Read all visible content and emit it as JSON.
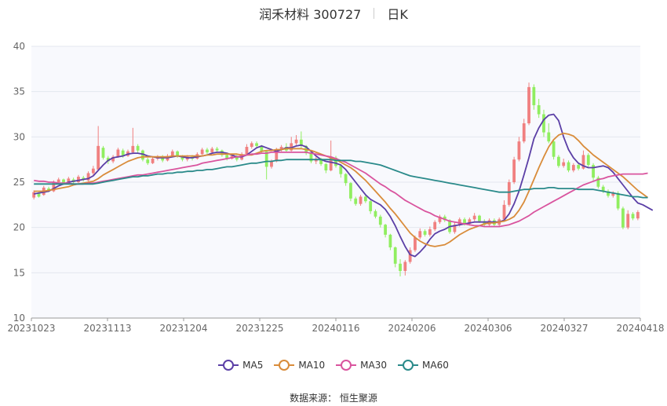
{
  "header": {
    "title": "润禾材料 300727",
    "period": "日K"
  },
  "source_text": "数据来源：  恒生聚源",
  "chart_data": {
    "type": "candlestick",
    "ylim": [
      10,
      40
    ],
    "yticks": [
      10,
      15,
      20,
      25,
      30,
      35,
      40
    ],
    "xtick_labels": [
      "20231023",
      "20231113",
      "20231204",
      "20231225",
      "20240116",
      "20240206",
      "20240306",
      "20240327",
      "20240418"
    ],
    "up_color": "#f08080",
    "down_color": "#90ee60",
    "grid": true,
    "legend_position": "bottom",
    "candles": [
      [
        23.3,
        23.9,
        23.1,
        24.1
      ],
      [
        23.8,
        23.4,
        23.3,
        23.9
      ],
      [
        23.6,
        24.4,
        23.5,
        24.6
      ],
      [
        24.3,
        24.1,
        23.9,
        24.5
      ],
      [
        24.0,
        25.0,
        23.9,
        25.2
      ],
      [
        25.0,
        25.3,
        24.8,
        25.5
      ],
      [
        25.3,
        24.9,
        24.7,
        25.4
      ],
      [
        24.9,
        25.4,
        24.8,
        25.6
      ],
      [
        25.3,
        25.0,
        24.8,
        25.5
      ],
      [
        25.0,
        25.6,
        24.9,
        25.8
      ],
      [
        25.5,
        25.3,
        25.1,
        25.7
      ],
      [
        25.2,
        26.0,
        25.1,
        26.2
      ],
      [
        26.0,
        26.5,
        25.8,
        26.8
      ],
      [
        26.4,
        29.0,
        26.3,
        31.2
      ],
      [
        28.8,
        27.7,
        27.5,
        29.0
      ],
      [
        27.7,
        27.3,
        27.0,
        27.9
      ],
      [
        27.3,
        27.8,
        27.1,
        28.0
      ],
      [
        27.8,
        28.6,
        27.7,
        28.8
      ],
      [
        28.5,
        27.9,
        27.7,
        28.7
      ],
      [
        27.9,
        28.4,
        27.8,
        28.6
      ],
      [
        28.3,
        29.0,
        28.1,
        31.0
      ],
      [
        29.0,
        28.5,
        28.2,
        29.2
      ],
      [
        28.5,
        27.5,
        27.3,
        28.6
      ],
      [
        27.5,
        27.1,
        26.9,
        27.7
      ],
      [
        27.1,
        27.6,
        27.0,
        27.8
      ],
      [
        27.6,
        27.8,
        27.4,
        28.0
      ],
      [
        27.8,
        27.4,
        27.2,
        28.0
      ],
      [
        27.4,
        27.9,
        27.3,
        28.1
      ],
      [
        27.9,
        28.4,
        27.8,
        28.6
      ],
      [
        28.4,
        27.9,
        27.7,
        28.5
      ],
      [
        27.9,
        27.5,
        27.3,
        28.0
      ],
      [
        27.5,
        27.8,
        27.3,
        28.0
      ],
      [
        27.8,
        27.6,
        27.4,
        28.0
      ],
      [
        27.6,
        28.1,
        27.5,
        28.3
      ],
      [
        28.1,
        28.6,
        28.0,
        28.8
      ],
      [
        28.6,
        28.3,
        28.1,
        28.8
      ],
      [
        28.3,
        28.7,
        28.2,
        28.9
      ],
      [
        28.7,
        28.5,
        28.3,
        28.9
      ],
      [
        28.5,
        28.0,
        27.8,
        28.6
      ],
      [
        28.0,
        27.6,
        27.4,
        28.1
      ],
      [
        27.6,
        27.9,
        27.5,
        28.1
      ],
      [
        27.9,
        27.5,
        27.3,
        28.0
      ],
      [
        27.5,
        28.1,
        27.4,
        28.3
      ],
      [
        28.1,
        28.9,
        28.0,
        29.2
      ],
      [
        28.9,
        29.3,
        28.7,
        29.5
      ],
      [
        29.3,
        29.0,
        28.8,
        29.5
      ],
      [
        29.0,
        28.4,
        28.2,
        29.1
      ],
      [
        28.4,
        26.7,
        25.3,
        28.5
      ],
      [
        26.7,
        27.3,
        26.5,
        27.5
      ],
      [
        27.3,
        28.6,
        27.2,
        28.8
      ],
      [
        28.6,
        28.9,
        28.4,
        29.1
      ],
      [
        28.9,
        28.5,
        28.3,
        29.3
      ],
      [
        28.5,
        29.3,
        28.4,
        30.0
      ],
      [
        29.3,
        29.7,
        29.1,
        30.2
      ],
      [
        29.7,
        29.0,
        28.8,
        30.6
      ],
      [
        29.0,
        28.2,
        28.0,
        29.1
      ],
      [
        28.2,
        27.3,
        27.1,
        28.3
      ],
      [
        27.3,
        27.6,
        27.0,
        27.8
      ],
      [
        27.6,
        27.0,
        26.8,
        27.7
      ],
      [
        27.0,
        26.3,
        26.0,
        27.1
      ],
      [
        26.3,
        27.7,
        26.2,
        29.6
      ],
      [
        27.7,
        26.8,
        26.6,
        27.9
      ],
      [
        26.8,
        25.9,
        25.5,
        26.9
      ],
      [
        25.9,
        24.9,
        24.6,
        26.0
      ],
      [
        24.9,
        23.2,
        22.9,
        25.0
      ],
      [
        23.2,
        22.6,
        22.4,
        23.4
      ],
      [
        22.6,
        23.4,
        22.4,
        23.6
      ],
      [
        23.4,
        22.9,
        22.7,
        23.6
      ],
      [
        22.9,
        21.8,
        21.5,
        23.0
      ],
      [
        21.8,
        21.2,
        21.0,
        22.0
      ],
      [
        21.2,
        20.3,
        20.0,
        21.4
      ],
      [
        20.3,
        19.2,
        18.9,
        20.4
      ],
      [
        19.2,
        17.8,
        17.5,
        19.3
      ],
      [
        17.8,
        16.0,
        15.6,
        17.9
      ],
      [
        16.0,
        15.2,
        14.6,
        16.5
      ],
      [
        15.2,
        16.2,
        14.7,
        16.4
      ],
      [
        16.2,
        17.5,
        16.0,
        17.8
      ],
      [
        17.5,
        18.9,
        17.3,
        19.1
      ],
      [
        18.9,
        19.6,
        18.7,
        19.9
      ],
      [
        19.6,
        19.2,
        19.0,
        19.8
      ],
      [
        19.2,
        19.8,
        19.0,
        20.1
      ],
      [
        19.8,
        20.6,
        19.6,
        20.8
      ],
      [
        20.6,
        21.2,
        20.4,
        21.4
      ],
      [
        21.2,
        20.8,
        20.6,
        21.4
      ],
      [
        20.8,
        19.5,
        19.3,
        20.9
      ],
      [
        19.5,
        20.3,
        19.3,
        20.6
      ],
      [
        20.3,
        20.9,
        20.1,
        21.1
      ],
      [
        20.9,
        20.4,
        20.2,
        21.1
      ],
      [
        20.4,
        20.9,
        20.2,
        21.1
      ],
      [
        20.9,
        21.3,
        20.7,
        21.6
      ],
      [
        21.3,
        20.7,
        20.5,
        21.4
      ],
      [
        20.7,
        20.3,
        20.1,
        20.9
      ],
      [
        20.3,
        20.8,
        20.1,
        21.0
      ],
      [
        20.8,
        20.3,
        20.1,
        21.0
      ],
      [
        20.3,
        20.9,
        20.1,
        21.1
      ],
      [
        20.9,
        22.5,
        20.8,
        23.0
      ],
      [
        22.5,
        25.0,
        22.3,
        25.3
      ],
      [
        25.0,
        27.5,
        24.8,
        27.8
      ],
      [
        27.5,
        29.5,
        27.3,
        30.0
      ],
      [
        29.5,
        31.5,
        29.3,
        32.0
      ],
      [
        31.5,
        35.5,
        31.3,
        36.0
      ],
      [
        35.5,
        33.5,
        33.0,
        35.8
      ],
      [
        33.5,
        32.5,
        32.1,
        34.2
      ],
      [
        32.5,
        30.5,
        30.0,
        33.0
      ],
      [
        30.5,
        29.5,
        29.3,
        31.5
      ],
      [
        29.5,
        27.8,
        27.5,
        29.7
      ],
      [
        27.8,
        26.8,
        26.6,
        28.0
      ],
      [
        26.8,
        27.2,
        26.6,
        27.6
      ],
      [
        27.2,
        26.3,
        26.1,
        27.4
      ],
      [
        26.3,
        26.9,
        26.1,
        27.1
      ],
      [
        26.9,
        26.5,
        26.3,
        27.1
      ],
      [
        26.5,
        28.0,
        26.4,
        28.5
      ],
      [
        28.0,
        26.9,
        26.7,
        28.2
      ],
      [
        26.9,
        25.5,
        25.2,
        27.1
      ],
      [
        25.5,
        24.5,
        24.3,
        25.7
      ],
      [
        24.5,
        24.0,
        23.8,
        24.7
      ],
      [
        24.0,
        23.5,
        23.3,
        24.2
      ],
      [
        23.5,
        23.8,
        23.3,
        24.0
      ],
      [
        23.8,
        22.1,
        21.9,
        24.0
      ],
      [
        22.1,
        20.0,
        19.8,
        22.3
      ],
      [
        20.0,
        21.5,
        19.8,
        21.9
      ],
      [
        21.5,
        21.0,
        20.8,
        21.7
      ],
      [
        21.0,
        21.7,
        20.8,
        21.9
      ]
    ],
    "series": [
      {
        "name": "MA5",
        "color": "#5b3fa6",
        "values": [
          23.7,
          23.8,
          23.9,
          24.0,
          24.3,
          24.6,
          24.8,
          25.0,
          25.1,
          25.2,
          25.3,
          25.4,
          25.7,
          26.3,
          26.9,
          27.4,
          27.7,
          27.8,
          27.9,
          28.1,
          28.2,
          28.2,
          28.1,
          27.9,
          27.8,
          27.7,
          27.7,
          27.7,
          27.8,
          27.9,
          27.8,
          27.7,
          27.7,
          27.8,
          27.9,
          28.0,
          28.2,
          28.3,
          28.3,
          28.2,
          28.0,
          27.8,
          27.8,
          28.0,
          28.4,
          28.8,
          29.0,
          28.8,
          28.6,
          28.4,
          28.6,
          28.8,
          28.8,
          29.0,
          29.1,
          28.9,
          28.4,
          27.9,
          27.5,
          27.3,
          27.2,
          27.1,
          26.9,
          26.4,
          25.7,
          25.0,
          24.3,
          23.6,
          23.1,
          22.8,
          22.5,
          22.0,
          21.2,
          20.2,
          19.0,
          17.9,
          17.0,
          16.8,
          17.3,
          17.9,
          18.7,
          19.3,
          19.6,
          19.8,
          20.1,
          20.2,
          20.3,
          20.4,
          20.5,
          20.6,
          20.6,
          20.6,
          20.6,
          20.6,
          20.6,
          20.8,
          21.5,
          22.6,
          24.0,
          25.8,
          27.7,
          29.8,
          31.0,
          31.9,
          32.4,
          32.5,
          31.8,
          30.0,
          28.6,
          27.7,
          27.1,
          26.8,
          26.6,
          26.6,
          26.7,
          26.8,
          26.6,
          26.1,
          25.4,
          24.7,
          24.0,
          23.3,
          22.7,
          22.5,
          22.2,
          21.9
        ]
      },
      {
        "name": "MA10",
        "color": "#d98c3a",
        "values": [
          24.0,
          24.0,
          24.0,
          24.1,
          24.2,
          24.3,
          24.4,
          24.5,
          24.7,
          24.8,
          24.9,
          25.0,
          25.1,
          25.4,
          25.8,
          26.1,
          26.4,
          26.7,
          27.0,
          27.3,
          27.5,
          27.7,
          27.8,
          27.8,
          27.8,
          27.8,
          27.8,
          27.8,
          27.9,
          27.9,
          27.9,
          27.9,
          27.9,
          27.9,
          27.9,
          28.0,
          28.0,
          28.1,
          28.1,
          28.1,
          28.1,
          28.1,
          28.0,
          28.0,
          28.0,
          28.2,
          28.4,
          28.5,
          28.5,
          28.6,
          28.6,
          28.7,
          28.7,
          28.7,
          28.7,
          28.6,
          28.5,
          28.3,
          28.1,
          27.9,
          27.7,
          27.5,
          27.2,
          26.9,
          26.6,
          26.2,
          25.7,
          25.2,
          24.6,
          24.0,
          23.4,
          22.8,
          22.1,
          21.5,
          20.8,
          20.1,
          19.4,
          18.9,
          18.5,
          18.2,
          18.0,
          17.9,
          18.0,
          18.1,
          18.4,
          18.8,
          19.2,
          19.5,
          19.8,
          20.0,
          20.2,
          20.4,
          20.5,
          20.5,
          20.6,
          20.7,
          20.9,
          21.2,
          21.9,
          22.8,
          24.0,
          25.3,
          26.6,
          27.8,
          28.9,
          29.7,
          30.2,
          30.4,
          30.3,
          30.1,
          29.6,
          29.0,
          28.5,
          28.0,
          27.6,
          27.2,
          26.8,
          26.4,
          26.0,
          25.6,
          25.1,
          24.6,
          24.1,
          23.7,
          23.3
        ]
      },
      {
        "name": "MA30",
        "color": "#d9549e",
        "values": [
          25.2,
          25.1,
          25.1,
          25.0,
          25.0,
          24.9,
          24.9,
          24.9,
          24.8,
          24.8,
          24.8,
          24.9,
          24.9,
          25.0,
          25.1,
          25.2,
          25.3,
          25.4,
          25.5,
          25.6,
          25.7,
          25.8,
          25.8,
          25.9,
          26.0,
          26.1,
          26.2,
          26.3,
          26.4,
          26.5,
          26.6,
          26.7,
          26.8,
          26.9,
          27.1,
          27.2,
          27.3,
          27.4,
          27.5,
          27.6,
          27.7,
          27.8,
          27.9,
          28.0,
          28.1,
          28.1,
          28.2,
          28.2,
          28.3,
          28.3,
          28.3,
          28.3,
          28.3,
          28.3,
          28.3,
          28.3,
          28.2,
          28.1,
          28.0,
          27.9,
          27.8,
          27.6,
          27.4,
          27.2,
          26.9,
          26.6,
          26.3,
          26.0,
          25.6,
          25.2,
          24.8,
          24.5,
          24.1,
          23.8,
          23.4,
          23.0,
          22.7,
          22.4,
          22.1,
          21.8,
          21.6,
          21.3,
          21.1,
          20.9,
          20.7,
          20.6,
          20.5,
          20.4,
          20.3,
          20.2,
          20.2,
          20.1,
          20.1,
          20.1,
          20.1,
          20.2,
          20.3,
          20.5,
          20.7,
          21.0,
          21.3,
          21.7,
          22.0,
          22.3,
          22.6,
          22.9,
          23.2,
          23.5,
          23.8,
          24.1,
          24.4,
          24.7,
          24.9,
          25.1,
          25.3,
          25.4,
          25.6,
          25.7,
          25.8,
          25.9,
          25.9,
          25.9,
          25.9,
          25.9,
          26.0
        ]
      },
      {
        "name": "MA60",
        "color": "#2a8a8a",
        "values": [
          24.8,
          24.8,
          24.8,
          24.8,
          24.8,
          24.8,
          24.8,
          24.8,
          24.8,
          24.8,
          24.8,
          24.8,
          24.8,
          24.9,
          25.0,
          25.1,
          25.2,
          25.3,
          25.4,
          25.5,
          25.6,
          25.6,
          25.7,
          25.7,
          25.8,
          25.9,
          25.9,
          26.0,
          26.0,
          26.1,
          26.1,
          26.2,
          26.2,
          26.3,
          26.3,
          26.4,
          26.4,
          26.5,
          26.6,
          26.7,
          26.7,
          26.8,
          26.9,
          27.0,
          27.1,
          27.1,
          27.2,
          27.3,
          27.3,
          27.4,
          27.4,
          27.5,
          27.5,
          27.5,
          27.5,
          27.5,
          27.5,
          27.5,
          27.5,
          27.5,
          27.5,
          27.4,
          27.4,
          27.4,
          27.4,
          27.3,
          27.3,
          27.2,
          27.1,
          27.0,
          26.9,
          26.7,
          26.5,
          26.3,
          26.1,
          25.9,
          25.7,
          25.6,
          25.5,
          25.4,
          25.3,
          25.2,
          25.1,
          25.0,
          24.9,
          24.8,
          24.7,
          24.6,
          24.5,
          24.4,
          24.3,
          24.2,
          24.1,
          24.0,
          23.9,
          23.9,
          23.9,
          24.0,
          24.1,
          24.2,
          24.2,
          24.3,
          24.3,
          24.3,
          24.4,
          24.4,
          24.3,
          24.3,
          24.3,
          24.3,
          24.2,
          24.2,
          24.2,
          24.2,
          24.1,
          24.0,
          23.9,
          23.8,
          23.7,
          23.6,
          23.5,
          23.4,
          23.4,
          23.3,
          23.3
        ]
      }
    ]
  }
}
